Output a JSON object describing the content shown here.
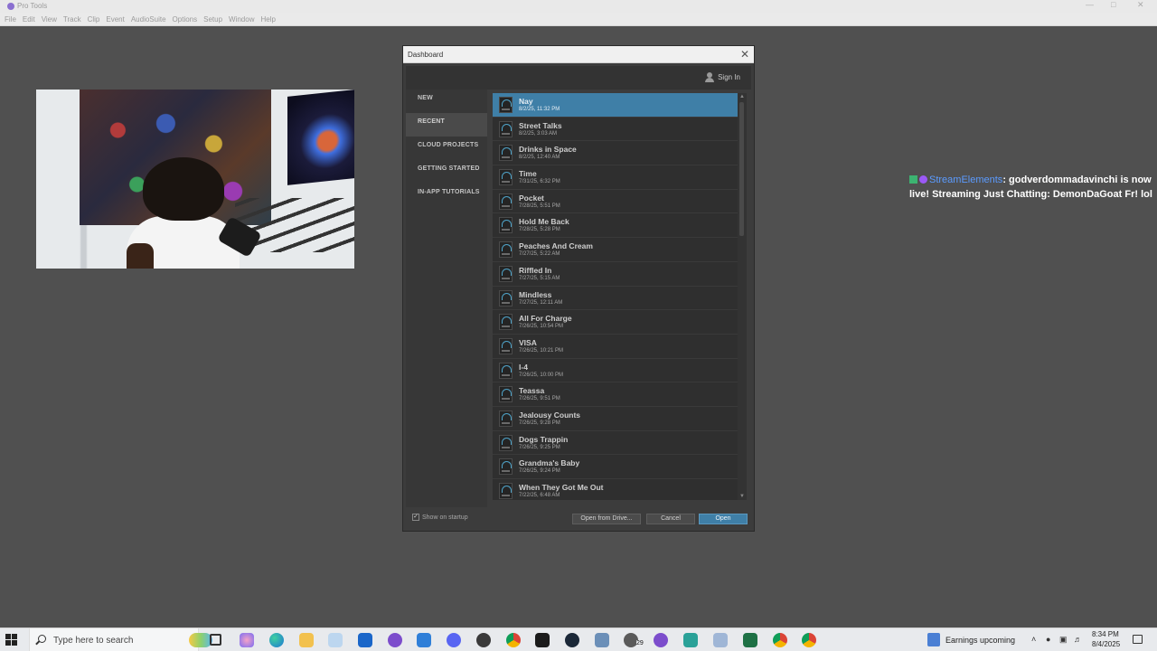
{
  "app": {
    "title": "Pro Tools",
    "menu": [
      "File",
      "Edit",
      "View",
      "Track",
      "Clip",
      "Event",
      "AudioSuite",
      "Options",
      "Setup",
      "Window",
      "Help"
    ]
  },
  "chat": {
    "username": "StreamElements",
    "message": ": godverdommadavinchi is now live! Streaming Just Chatting: DemonDaGoat Fr! lol"
  },
  "dashboard": {
    "title": "Dashboard",
    "sign_in": "Sign In",
    "nav": [
      {
        "label": "NEW",
        "active": false
      },
      {
        "label": "RECENT",
        "active": true
      },
      {
        "label": "CLOUD PROJECTS",
        "active": false
      },
      {
        "label": "GETTING STARTED",
        "active": false
      },
      {
        "label": "IN-APP TUTORIALS",
        "active": false
      }
    ],
    "sessions": [
      {
        "name": "Nay",
        "date": "8/2/25, 11:32 PM",
        "selected": true
      },
      {
        "name": "Street Talks",
        "date": "8/2/25, 3:03 AM"
      },
      {
        "name": "Drinks in Space",
        "date": "8/2/25, 12:40 AM"
      },
      {
        "name": "Time",
        "date": "7/31/25, 6:32 PM"
      },
      {
        "name": "Pocket",
        "date": "7/28/25, 5:51 PM"
      },
      {
        "name": "Hold Me Back",
        "date": "7/28/25, 5:28 PM"
      },
      {
        "name": "Peaches And Cream",
        "date": "7/27/25, 5:22 AM"
      },
      {
        "name": "Riffled In",
        "date": "7/27/25, 5:15 AM"
      },
      {
        "name": "Mindless",
        "date": "7/27/25, 12:11 AM"
      },
      {
        "name": "All For Charge",
        "date": "7/26/25, 10:54 PM"
      },
      {
        "name": "VISA",
        "date": "7/26/25, 10:21 PM"
      },
      {
        "name": "I-4",
        "date": "7/26/25, 10:00 PM"
      },
      {
        "name": "Teassa",
        "date": "7/26/25, 9:51 PM"
      },
      {
        "name": "Jealousy Counts",
        "date": "7/26/25, 9:28 PM"
      },
      {
        "name": "Dogs Trappin",
        "date": "7/26/25, 9:25 PM"
      },
      {
        "name": "Grandma's Baby",
        "date": "7/26/25, 9:24 PM"
      },
      {
        "name": "When They Got Me Out",
        "date": "7/22/25, 6:48 AM"
      }
    ],
    "show_on_startup": "Show on startup",
    "show_on_startup_checked": true,
    "buttons": {
      "open_from_drive": "Open from Drive...",
      "cancel": "Cancel",
      "open": "Open"
    }
  },
  "taskbar": {
    "search_placeholder": "Type here to search",
    "badge_count": "29",
    "earnings": "Earnings upcoming",
    "time": "8:34 PM",
    "date": "8/4/2025",
    "icons": [
      "task-view",
      "copilot",
      "edge",
      "file-explorer",
      "photos",
      "outlook",
      "pro-tools",
      "store",
      "discord",
      "media-player",
      "chrome",
      "adobe",
      "steam",
      "app",
      "whatsapp",
      "pro-tools",
      "app",
      "app",
      "excel",
      "chrome",
      "chrome"
    ]
  },
  "colors": {
    "accent": "#3f7fa7",
    "dialog_bg": "#3c3c3c",
    "desktop_bg": "#505050"
  }
}
